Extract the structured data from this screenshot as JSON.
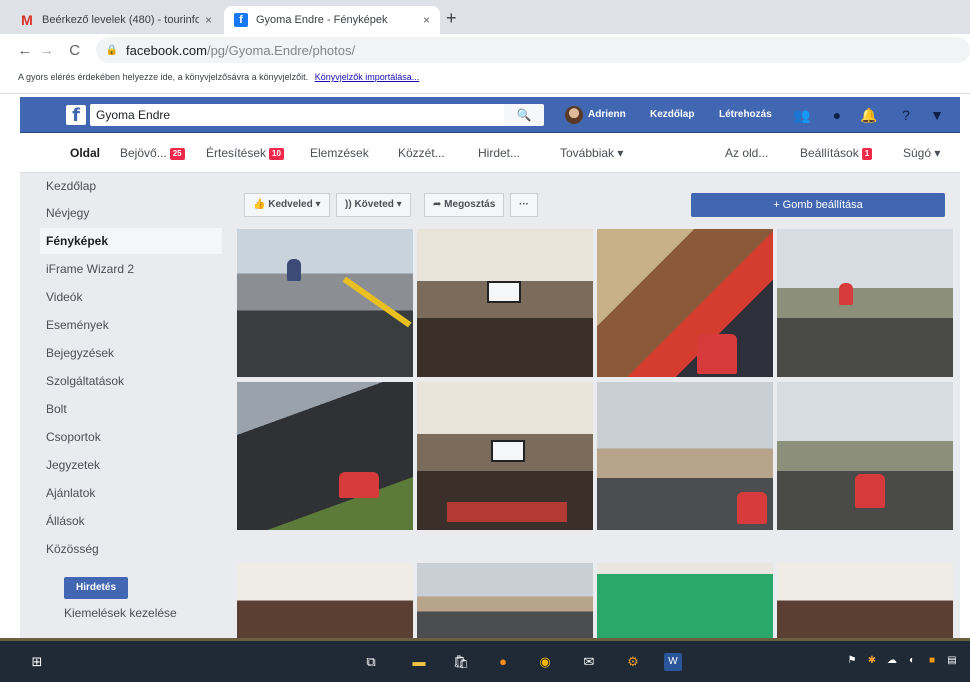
{
  "browser": {
    "tabs": [
      {
        "title": "Beérkező levelek (480) - tourinfo",
        "favicon": "gmail-icon",
        "active": false
      },
      {
        "title": "Gyoma Endre - Fényképek",
        "favicon": "facebook-icon",
        "active": true
      }
    ],
    "new_tab": "+",
    "close": "×",
    "url_host": "facebook.com",
    "url_path": "/pg/Gyoma.Endre/photos/",
    "bookmark_hint": "A gyors elérés érdekében helyezze ide, a könyvjelzősávra a könyvjelzőit.",
    "bookmark_link": "Könyvjelzők importálása..."
  },
  "fb_header": {
    "logo": "f",
    "search_value": "Gyoma Endre",
    "user": "Adrienn",
    "home": "Kezdőlap",
    "create": "Létrehozás",
    "color": "#4267b2"
  },
  "subnav": {
    "items": [
      {
        "label": "Oldal",
        "active": true
      },
      {
        "label": "Bejövő...",
        "badge": "25"
      },
      {
        "label": "Értesítések",
        "badge": "10"
      },
      {
        "label": "Elemzések"
      },
      {
        "label": "Közzét..."
      },
      {
        "label": "Hirdet..."
      },
      {
        "label": "Továbbiak ▾"
      },
      {
        "label": "Az old..."
      },
      {
        "label": "Beállítások",
        "badge": "1"
      },
      {
        "label": "Súgó ▾"
      }
    ]
  },
  "left_nav": {
    "items": [
      "Kezdőlap",
      "Névjegy",
      "Fényképek",
      "iFrame Wizard 2",
      "Videók",
      "Események",
      "Bejegyzések",
      "Szolgáltatások",
      "Bolt",
      "Csoportok",
      "Jegyzetek",
      "Ajánlatok",
      "Állások",
      "Közösség"
    ],
    "active": "Fényképek",
    "promote_button": "Hirdetés",
    "promote_manage": "Kiemelések kezelése"
  },
  "actions": {
    "like": "Kedveled ▾",
    "follow": "Követed ▾",
    "share": "Megosztás",
    "more": "···",
    "cta": "+ Gomb beállítása"
  },
  "photos": [
    "street-kids",
    "lecture-hall",
    "art-workshop",
    "bike-path",
    "road-cyclists",
    "hall-audience",
    "street-school",
    "bike-lane",
    "hall-event",
    "town-street",
    "green-tshirts",
    "room-window"
  ],
  "taskbar": {
    "icons": [
      "windows-start-icon",
      "task-view-icon",
      "file-explorer-icon",
      "store-icon",
      "firefox-icon",
      "chrome-icon",
      "mail-icon",
      "settings-icon",
      "word-icon"
    ]
  }
}
